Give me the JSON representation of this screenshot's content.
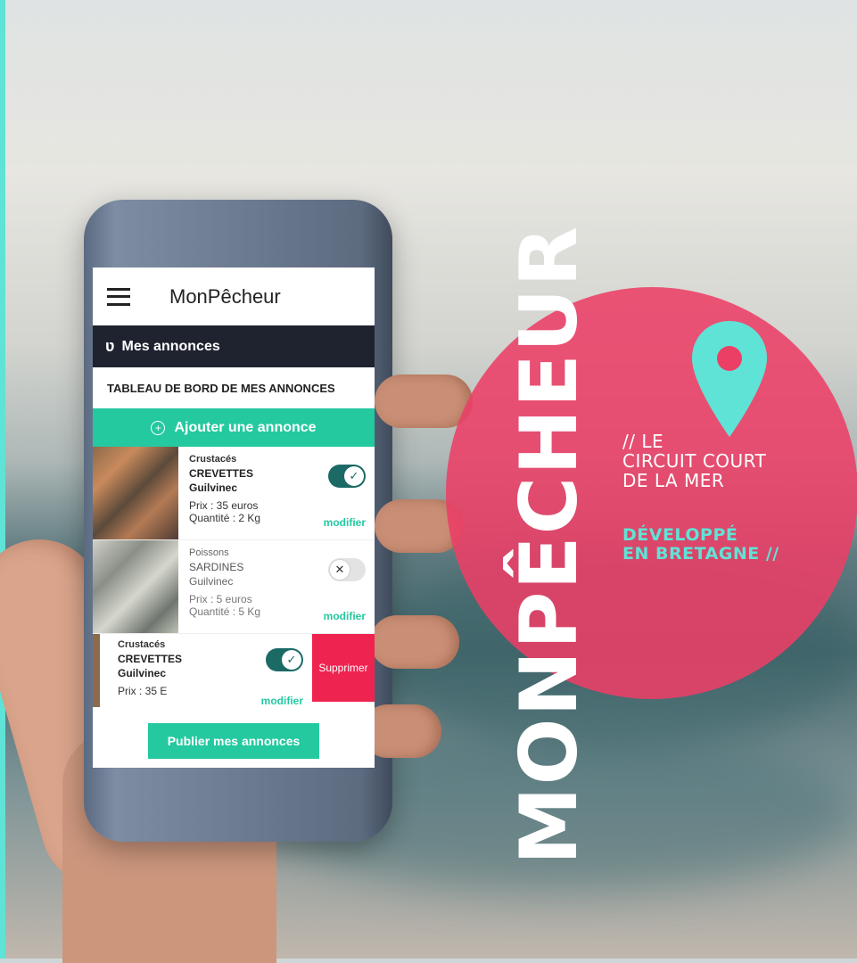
{
  "app": {
    "title": "MonPêcheur"
  },
  "section": {
    "label": "Mes annonces"
  },
  "dashboard": {
    "title": "TABLEAU DE BORD DE MES ANNONCES",
    "add_button": "Ajouter une annonce",
    "publish_button": "Publier mes annonces"
  },
  "listings": [
    {
      "category": "Crustacés",
      "name": "CREVETTES",
      "location": "Guilvinec",
      "price": "Prix : 35 euros",
      "quantity": "Quantité : 2 Kg",
      "active": true,
      "modify": "modifier"
    },
    {
      "category": "Poissons",
      "name": "SARDINES",
      "location": "Guilvinec",
      "price": "Prix : 5 euros",
      "quantity": "Quantité : 5 Kg",
      "active": false,
      "modify": "modifier"
    },
    {
      "category": "Crustacés",
      "name": "CREVETTES",
      "location": "Guilvinec",
      "price": "Prix : 35 E",
      "active": true,
      "modify": "modifier",
      "delete": "Supprimer"
    }
  ],
  "branding": {
    "vertical_title": "MONPÊCHEUR",
    "tagline_1": "// LE",
    "tagline_2": "CIRCUIT COURT",
    "tagline_3": "DE LA MER",
    "tagline_4": "DÉVELOPPÉ",
    "tagline_5": "EN BRETAGNE //"
  },
  "colors": {
    "accent_green": "#24c9a0",
    "accent_cyan": "#5fe3d6",
    "pink": "#ec3f66",
    "dark": "#1f2330",
    "delete_red": "#ef2350"
  },
  "icons": {
    "menu": "hamburger-icon",
    "section": "fish-hook-icon",
    "add": "plus-circle-icon",
    "toggle_on": "check-icon",
    "toggle_off": "x-icon",
    "pin": "location-pin-icon"
  }
}
